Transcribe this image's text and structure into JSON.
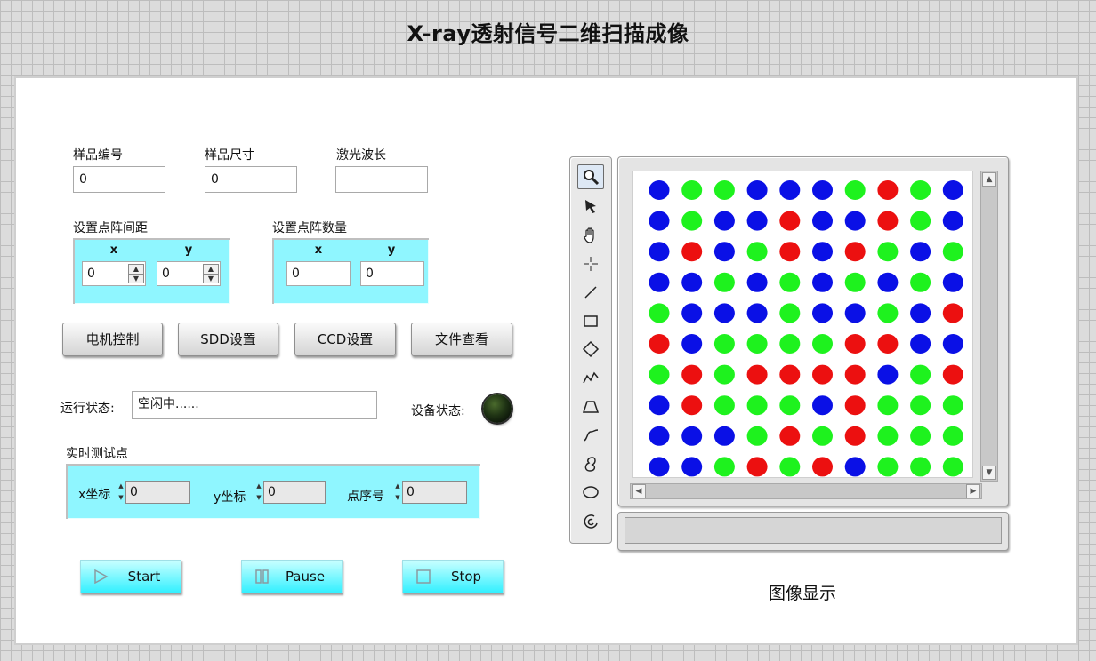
{
  "title": "X-ray透射信号二维扫描成像",
  "sample": {
    "id_label": "样品编号",
    "id_value": "0",
    "size_label": "样品尺寸",
    "size_value": "0",
    "wavelength_label": "激光波长",
    "wavelength_value": ""
  },
  "spacing": {
    "label": "设置点阵间距",
    "x_label": "x",
    "y_label": "y",
    "x_value": "0",
    "y_value": "0"
  },
  "count": {
    "label": "设置点阵数量",
    "x_label": "x",
    "y_label": "y",
    "x_value": "0",
    "y_value": "0"
  },
  "buttons": {
    "motor": "电机控制",
    "sdd": "SDD设置",
    "ccd": "CCD设置",
    "files": "文件查看"
  },
  "status": {
    "run_label": "运行状态:",
    "run_value": "空闲中......",
    "device_label": "设备状态:",
    "device_led_color": "#1f3314"
  },
  "realtime": {
    "label": "实时测试点",
    "x_label": "x坐标",
    "x_value": "0",
    "y_label": "y坐标",
    "y_value": "0",
    "idx_label": "点序号",
    "idx_value": "0"
  },
  "controls": {
    "start": "Start",
    "pause": "Pause",
    "stop": "Stop"
  },
  "image_caption": "图像显示",
  "palette_tools": [
    "zoom-icon",
    "arrow-cursor-icon",
    "hand-icon",
    "crosshair-icon",
    "line-icon",
    "rectangle-icon",
    "diamond-icon",
    "polyline-icon",
    "polygon-icon",
    "freehand-icon",
    "closed-freehand-icon",
    "ellipse-icon",
    "annulus-icon"
  ],
  "colors": {
    "blue": "#0a10e6",
    "green": "#1ef21e",
    "red": "#ec1010",
    "cyan": "#8ff6ff"
  },
  "grid": [
    "BGGBBBGRGB",
    "BGBBRBBRGB",
    "BRBGRBRGBG",
    "BBGBGBGBGB",
    "GBBBGBBGBR",
    "RBGGGGRRBB",
    "GRGRRRRBGR",
    "BRGGGBRGGG",
    "BBBGRGRGGG",
    "BBGRGRBGGG"
  ]
}
